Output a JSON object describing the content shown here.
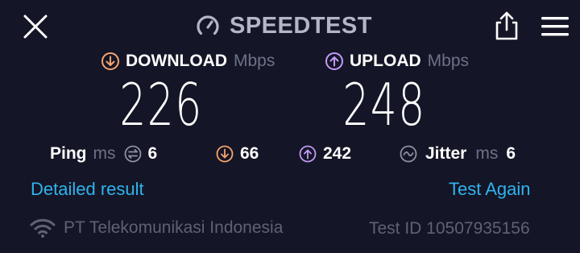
{
  "header": {
    "title": "SPEEDTEST",
    "close_icon": "close-icon",
    "logo_icon": "speedometer-icon",
    "share_icon": "share-icon",
    "menu_icon": "hamburger-menu-icon"
  },
  "download": {
    "label": "DOWNLOAD",
    "unit": "Mbps",
    "value": "226",
    "color": "#f7a46e"
  },
  "upload": {
    "label": "UPLOAD",
    "unit": "Mbps",
    "value": "248",
    "color": "#c39af8"
  },
  "stats": {
    "ping_label": "Ping",
    "ping_unit": "ms",
    "ping_idle": "6",
    "ping_download": "66",
    "ping_upload": "242",
    "jitter_label": "Jitter",
    "jitter_unit": "ms",
    "jitter_value": "6"
  },
  "actions": {
    "detailed_result": "Detailed result",
    "test_again": "Test Again",
    "link_color": "#2fb4ee"
  },
  "footer": {
    "isp": "PT Telekomunikasi Indonesia",
    "test_id": "Test ID 10507935156"
  }
}
